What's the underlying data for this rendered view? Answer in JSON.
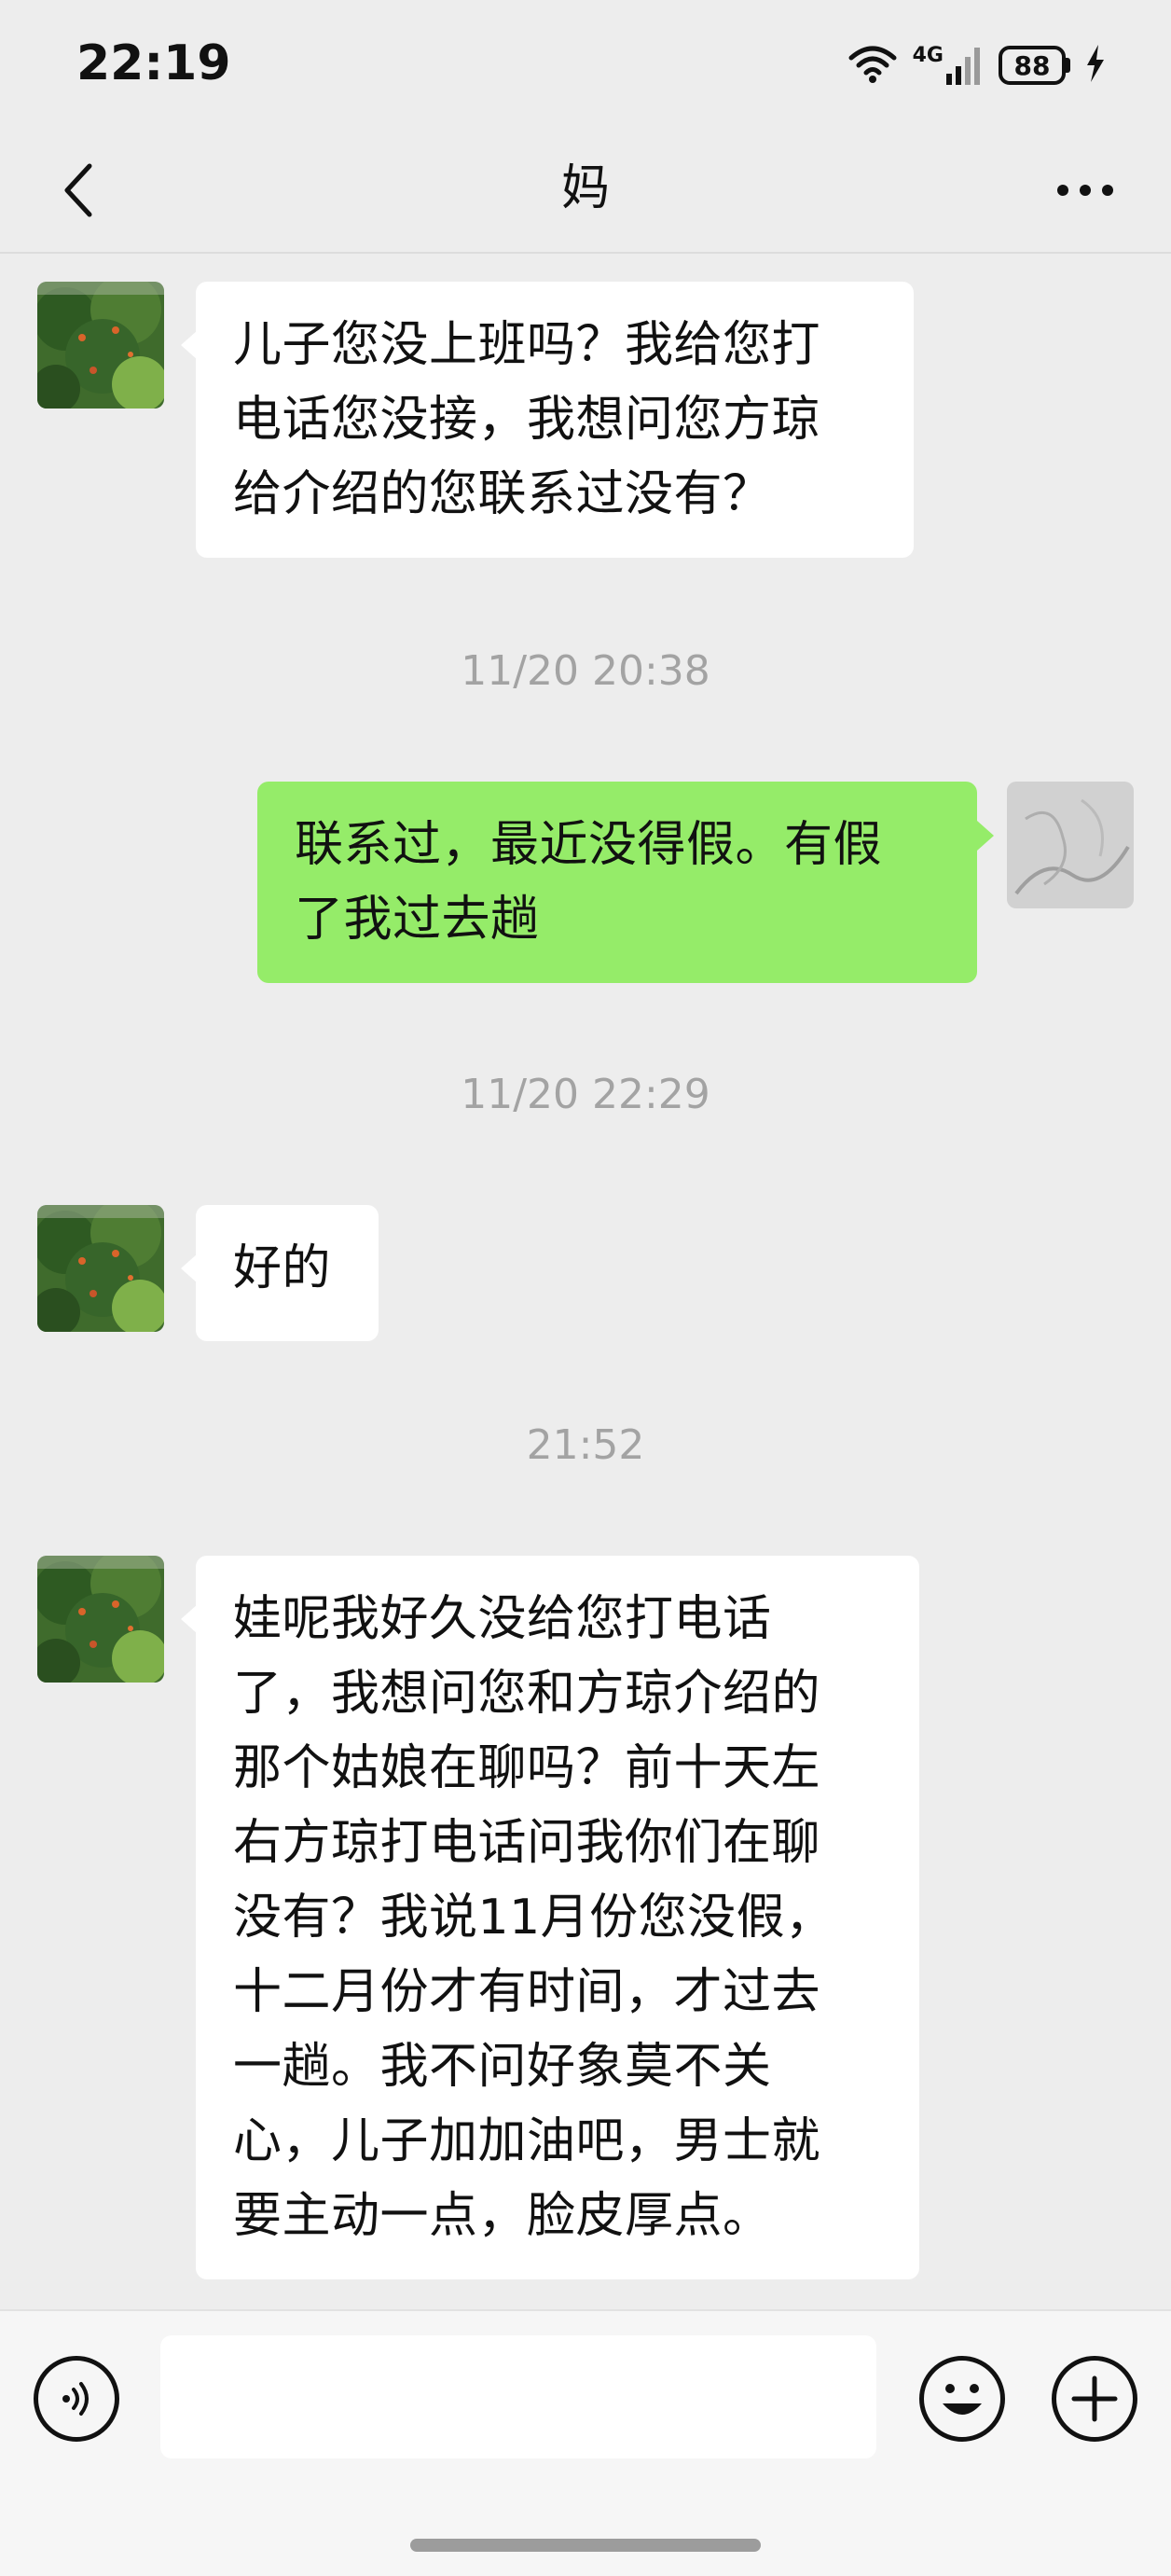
{
  "status_bar": {
    "time": "22:19",
    "network": "4G",
    "battery": "88"
  },
  "nav": {
    "title": "妈"
  },
  "messages": [
    {
      "side": "in",
      "text": "儿子您没上班吗？我给您打\n电话您没接，我想问您方琼\n给介绍的您联系过没有？"
    },
    {
      "side": "out",
      "text": "联系过，最近没得假。有假\n了我过去趟"
    },
    {
      "side": "in",
      "text": "好的"
    },
    {
      "side": "in",
      "text": "娃呢我好久没给您打电话\n了，我想问您和方琼介绍的\n那个姑娘在聊吗？前十天左\n右方琼打电话问我你们在聊\n没有？我说11月份您没假，\n十二月份才有时间，才过去\n一趟。我不问好象莫不关\n心，儿子加加油吧，男士就\n要主动一点，脸皮厚点。"
    }
  ],
  "timestamps": [
    "11/20 20:38",
    "11/20 22:29",
    "21:52"
  ],
  "input": {
    "value": "",
    "placeholder": ""
  },
  "colors": {
    "background": "#ededed",
    "incoming_bubble": "#ffffff",
    "outgoing_bubble": "#95ec69",
    "timestamp_text": "#a3a3a3"
  },
  "icons": [
    "back-icon",
    "more-icon",
    "voice-icon",
    "emoji-icon",
    "plus-icon",
    "wifi-icon",
    "signal-icon",
    "charging-icon"
  ]
}
